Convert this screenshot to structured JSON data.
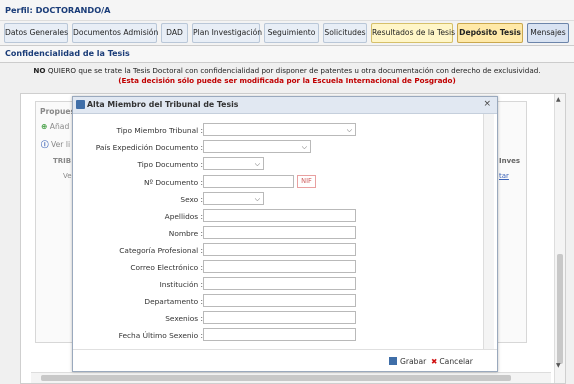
{
  "profile": "Perfil: DOCTORANDO/A",
  "tabs": [
    "Datos Generales",
    "Documentos Admisión",
    "DAD",
    "Plan Investigación",
    "Seguimiento",
    "Solicitudes",
    "Resultados de la Tesis",
    "Depósito Tesis",
    "Mensajes"
  ],
  "confid_title": "Confidencialidad de la Tesis",
  "notice": {
    "no": "NO",
    "rest": " QUIERO que se trate la Tesis Doctoral con confidencialidad por disponer de patentes u otra documentación con derecho de exclusividad.",
    "warning": "(Esta decisión sólo puede ser modificada por la Escuela Internacional de Posgrado)"
  },
  "background": {
    "title": "Propues",
    "add": "Añad",
    "ver": "Ver li",
    "trib": "TRIB",
    "inves": "Inves",
    "ve": "Ve",
    "tar": "tar"
  },
  "dialog": {
    "title": "Alta Miembro del Tribunal de Tesis",
    "close": "×",
    "labels": {
      "tipo_miembro": "Tipo Miembro Tribunal :",
      "pais": "País Expedición Documento :",
      "tipo_doc": "Tipo Documento :",
      "num_doc": "Nº Documento :",
      "sexo": "Sexo :",
      "apellidos": "Apellidos :",
      "nombre": "Nombre :",
      "categoria": "Categoría Profesional :",
      "correo": "Correo Electrónico :",
      "institucion": "Institución :",
      "departamento": "Departamento :",
      "sexenios": "Sexenios :",
      "fecha": "Fecha Último Sexenio :"
    },
    "nif": "NIF",
    "grabar": "Grabar",
    "cancelar": "Cancelar"
  }
}
